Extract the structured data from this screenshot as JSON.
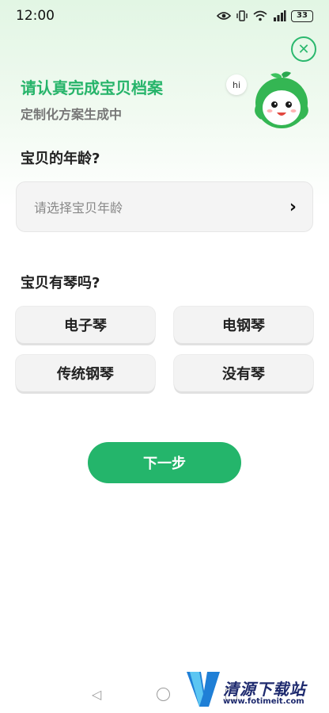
{
  "status_bar": {
    "time": "12:00",
    "battery": "33"
  },
  "header": {
    "title": "请认真完成宝贝档案",
    "subtitle": "定制化方案生成中",
    "mascot_greeting": "hi",
    "close_icon": "close-icon"
  },
  "questions": {
    "age": {
      "label": "宝贝的年龄?",
      "placeholder": "请选择宝贝年龄",
      "chevron": "›"
    },
    "piano": {
      "label": "宝贝有琴吗?",
      "options": [
        "电子琴",
        "电钢琴",
        "传统钢琴",
        "没有琴"
      ]
    }
  },
  "actions": {
    "next_label": "下一步"
  },
  "watermark": {
    "title": "清源下载站",
    "url": "www.fotimeit.com"
  },
  "colors": {
    "accent": "#24b56b",
    "title_green": "#26b46a",
    "background_tint": "#e2f6e4"
  }
}
